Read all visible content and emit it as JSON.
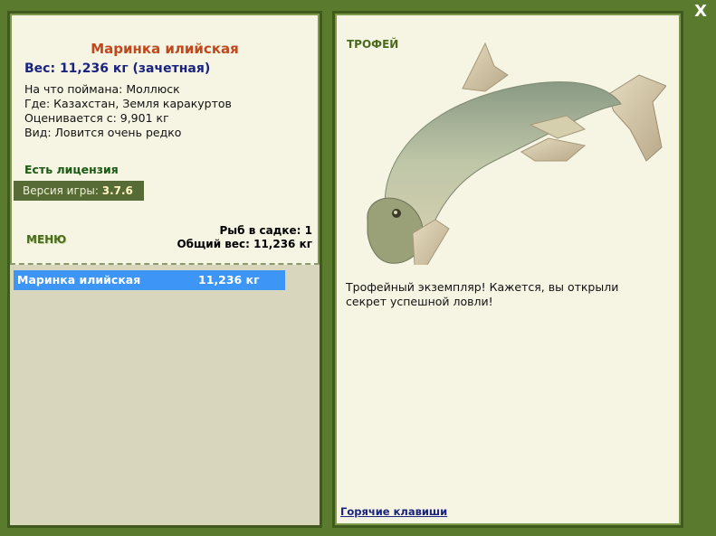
{
  "window": {
    "close_label": "X"
  },
  "fish": {
    "name": "Маринка илийская",
    "weight_line": "Вес: 11,236 кг (зачетная)",
    "bait": "На что поймана: Моллюск",
    "location": "Где: Казахстан, Земля каракуртов",
    "valued_from": "Оценивается с: 9,901 кг",
    "rarity": "Вид: Ловится очень редко"
  },
  "license": "Есть лицензия",
  "version": {
    "label": "Версия игры:",
    "value": "3.7.6"
  },
  "menu_label": "МЕНЮ",
  "keepnet": {
    "count_line": "Рыб в садке: 1",
    "total_weight_line": "Общий вес: 11,236 кг",
    "items": [
      {
        "name": "Маринка илийская",
        "weight": "11,236 кг"
      }
    ]
  },
  "trophy": {
    "label": "ТРОФЕЙ",
    "message": "Трофейный экземпляр! Кажется, вы открыли секрет успешной ловли!"
  },
  "hotkeys_link": "Горячие клавиши",
  "colors": {
    "background": "#5a7a2e",
    "panel": "#f6f4e2",
    "title": "#c0481c",
    "weight": "#1a237e",
    "license": "#1a5a12",
    "keepnet_selected": "#3d96f5"
  },
  "icons": {
    "close": "close-icon",
    "fish": "fish-image"
  }
}
